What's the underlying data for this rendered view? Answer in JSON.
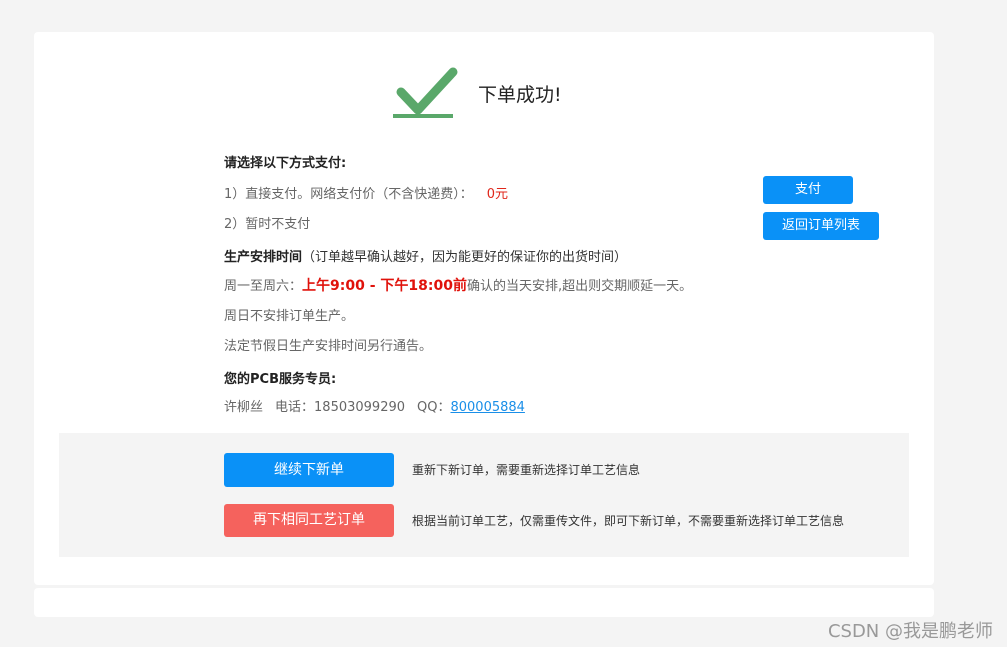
{
  "success": {
    "title": "下单成功!",
    "icon": "checkmark-icon",
    "color": "#5aa86a"
  },
  "payment": {
    "heading": "请选择以下方式支付:",
    "option1_label": "1）直接支付。网络支付价（不含快递费）：",
    "option1_price": "0元",
    "option2_label": "2）暂时不支付",
    "pay_button": "支付",
    "back_button": "返回订单列表"
  },
  "schedule": {
    "heading": "生产安排时间",
    "heading_note": "（订单越早确认越好，因为能更好的保证你的出货时间）",
    "weekday_prefix": "周一至周六：",
    "weekday_hours": "上午9:00 - 下午18:00前",
    "weekday_suffix": "确认的当天安排,超出则交期顺延一天。",
    "sunday_note": "周日不安排订单生产。",
    "holiday_note": "法定节假日生产安排时间另行通告。"
  },
  "service": {
    "heading": "您的PCB服务专员:",
    "name": "许柳丝",
    "phone_label": "电话：",
    "phone": "18503099290",
    "qq_label": "QQ：",
    "qq": "800005884"
  },
  "actions": {
    "new_order_button": "继续下新单",
    "new_order_note": "重新下新订单，需要重新选择订单工艺信息",
    "same_order_button": "再下相同工艺订单",
    "same_order_note": "根据当前订单工艺，仅需重传文件，即可下新订单，不需要重新选择订单工艺信息"
  },
  "colors": {
    "primary_blue": "#0a91f7",
    "accent_red": "#f5625d",
    "highlight_red": "#e0120b"
  },
  "watermark": "CSDN @我是鹏老师"
}
